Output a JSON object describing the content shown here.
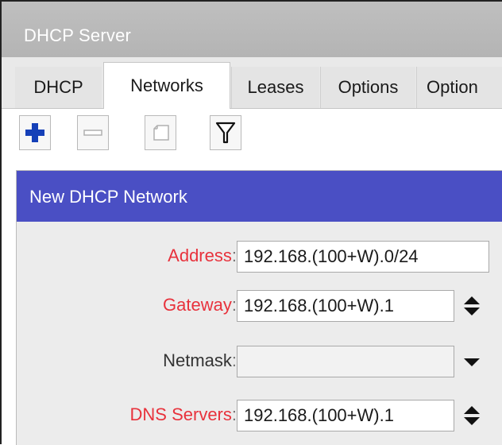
{
  "window": {
    "title": "DHCP Server"
  },
  "tabs": [
    {
      "label": "DHCP"
    },
    {
      "label": "Networks"
    },
    {
      "label": "Leases"
    },
    {
      "label": "Options"
    },
    {
      "label": "Option"
    }
  ],
  "active_tab": "Networks",
  "toolbar": {
    "buttons": [
      "add-icon",
      "remove-icon",
      "comment-icon",
      "filter-icon"
    ],
    "add_color": "#1540b8"
  },
  "dialog": {
    "title": "New DHCP Network",
    "header_color": "#4a4fc4",
    "fields": {
      "address": {
        "label": "Address",
        "colon": ":",
        "value": "192.168.(100+W).0/24"
      },
      "gateway": {
        "label": "Gateway",
        "colon": ":",
        "value": "192.168.(100+W).1"
      },
      "netmask": {
        "label": "Netmask",
        "colon": ":",
        "value": ""
      },
      "dns": {
        "label": "DNS Servers",
        "colon": ":",
        "value": "192.168.(100+W).1"
      }
    },
    "label_colors": {
      "required": "#e8323c",
      "optional": "#333333"
    }
  }
}
